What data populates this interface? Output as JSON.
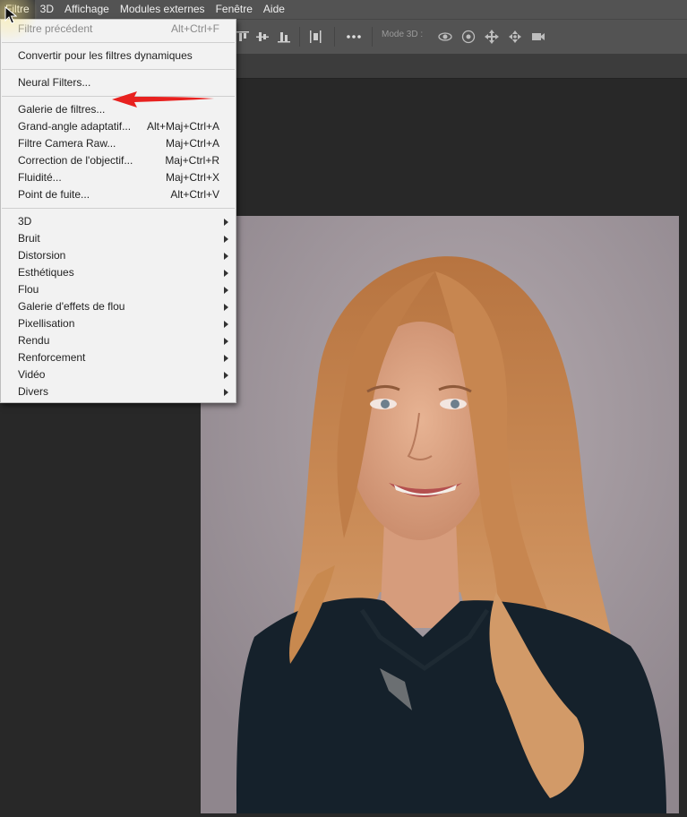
{
  "menubar": {
    "items": [
      "Filtre",
      "3D",
      "Affichage",
      "Modules externes",
      "Fenêtre",
      "Aide"
    ]
  },
  "optionsbar": {
    "mode3d_label": "Mode 3D :",
    "icons": [
      "align-top-icon",
      "align-vcenter-icon",
      "align-bottom-icon",
      "distribute-icon",
      "more-icon",
      "orbit-3d-icon",
      "roll-3d-icon",
      "pan-3d-icon",
      "slide-3d-icon",
      "camera-3d-icon"
    ]
  },
  "filter_menu": {
    "last_filter": {
      "label": "Filtre précédent",
      "shortcut": "Alt+Ctrl+F"
    },
    "smart_filters": {
      "label": "Convertir pour les filtres dynamiques"
    },
    "neural_filters": {
      "label": "Neural Filters..."
    },
    "group1": [
      {
        "label": "Galerie de filtres...",
        "shortcut": ""
      },
      {
        "label": "Grand-angle adaptatif...",
        "shortcut": "Alt+Maj+Ctrl+A"
      },
      {
        "label": "Filtre Camera Raw...",
        "shortcut": "Maj+Ctrl+A"
      },
      {
        "label": "Correction de l'objectif...",
        "shortcut": "Maj+Ctrl+R"
      },
      {
        "label": "Fluidité...",
        "shortcut": "Maj+Ctrl+X"
      },
      {
        "label": "Point de fuite...",
        "shortcut": "Alt+Ctrl+V"
      }
    ],
    "submenus": [
      "3D",
      "Bruit",
      "Distorsion",
      "Esthétiques",
      "Flou",
      "Galerie d'effets de flou",
      "Pixellisation",
      "Rendu",
      "Renforcement",
      "Vidéo",
      "Divers"
    ]
  },
  "colors": {
    "accent_arrow": "#e8211f",
    "menu_bg": "#f2f2f2",
    "ui_bg": "#535353",
    "canvas_bg": "#282828"
  }
}
